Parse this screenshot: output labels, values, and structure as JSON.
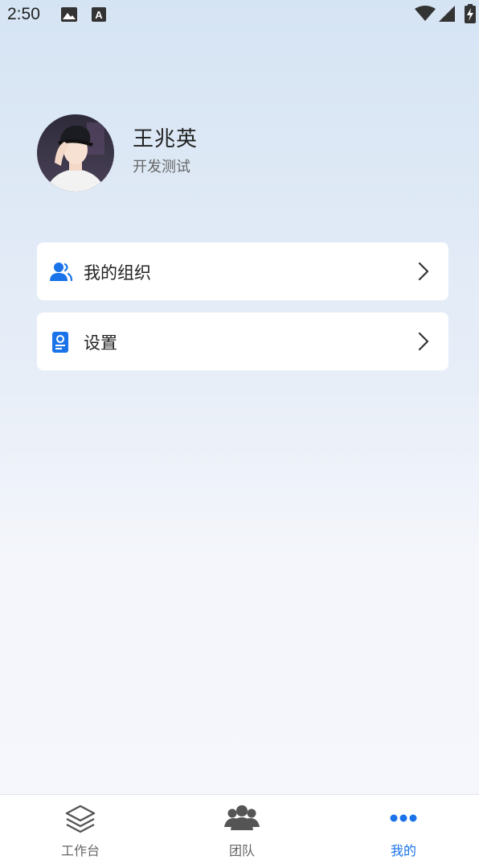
{
  "status_bar": {
    "time": "2:50",
    "icons": [
      "image-icon",
      "a-icon",
      "wifi-icon",
      "signal-icon",
      "battery-charging-icon"
    ]
  },
  "profile": {
    "name": "王兆英",
    "role": "开发测试",
    "avatar": "avatar-photo"
  },
  "menu": {
    "items": [
      {
        "label": "我的组织",
        "icon": "organization-icon"
      },
      {
        "label": "设置",
        "icon": "settings-icon"
      }
    ]
  },
  "bottom_nav": {
    "items": [
      {
        "label": "工作台",
        "icon": "layers-icon",
        "active": false
      },
      {
        "label": "团队",
        "icon": "team-icon",
        "active": false
      },
      {
        "label": "我的",
        "icon": "more-dots-icon",
        "active": true
      }
    ]
  },
  "colors": {
    "accent": "#1a73e8",
    "background_top": "#d5e4f3",
    "background_bottom": "#f5f7fc"
  }
}
